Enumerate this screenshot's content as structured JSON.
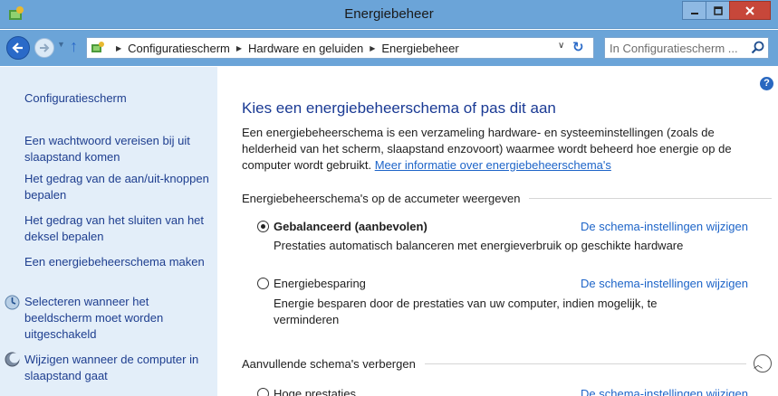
{
  "window": {
    "title": "Energiebeheer",
    "minimize_icon": "minimize-icon",
    "maximize_icon": "maximize-icon",
    "close_icon": "close-icon"
  },
  "addressbar": {
    "breadcrumbs": [
      "Configuratiescherm",
      "Hardware en geluiden",
      "Energiebeheer"
    ],
    "search_placeholder": "In Configuratiescherm ..."
  },
  "sidebar": {
    "home_link": "Configuratiescherm",
    "links": [
      "Een wachtwoord vereisen bij uit slaapstand komen",
      "Het gedrag van de aan/uit-knoppen bepalen",
      "Het gedrag van het sluiten van het deksel bepalen",
      "Een energiebeheerschema maken",
      "Selecteren wanneer het beeldscherm moet worden uitgeschakeld",
      "Wijzigen wanneer de computer in slaapstand gaat"
    ]
  },
  "main": {
    "title": "Kies een energiebeheerschema of pas dit aan",
    "intro_text": "Een energiebeheerschema is een verzameling hardware- en systeeminstellingen (zoals de helderheid van het scherm, slaapstand enzovoort) waarmee wordt beheerd hoe energie op de computer wordt gebruikt. ",
    "intro_link": "Meer informatie over energiebeheerschema's",
    "section_battery": "Energiebeheerschema's op de accumeter weergeven",
    "section_additional": "Aanvullende schema's verbergen",
    "plans": [
      {
        "name": "Gebalanceerd (aanbevolen)",
        "selected": true,
        "link": "De schema-instellingen wijzigen",
        "description": "Prestaties automatisch balanceren met energieverbruik op geschikte hardware"
      },
      {
        "name": "Energiebesparing",
        "selected": false,
        "link": "De schema-instellingen wijzigen",
        "description": "Energie besparen door de prestaties van uw computer, indien mogelijk, te verminderen"
      },
      {
        "name": "Hoge prestaties",
        "selected": false,
        "link": "De schema-instellingen wijzigen"
      }
    ]
  },
  "colors": {
    "chrome": "#6ba4d8",
    "sidebar_bg": "#e3eef9",
    "link": "#1d64c8",
    "title": "#1a3a94"
  }
}
